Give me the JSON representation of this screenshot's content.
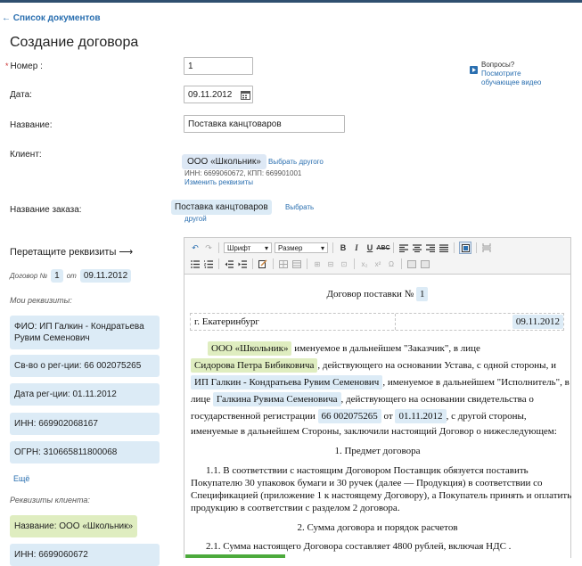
{
  "nav": {
    "back_label": "← Список документов"
  },
  "page": {
    "title": "Создание договора"
  },
  "help": {
    "title": "Вопросы?",
    "link_line1": "Посмотрите",
    "link_line2": "обучающее видео"
  },
  "form": {
    "number": {
      "label": "Номер :",
      "value": "1"
    },
    "date": {
      "label": "Дата:",
      "value": "09.11.2012"
    },
    "name": {
      "label": "Название:",
      "value": "Поставка канцтоваров"
    },
    "client": {
      "label": "Клиент:",
      "chip": "ООО «Школьник»",
      "choose_other": "Выбрать другого",
      "details": "ИНН: 6699060672, КПП: 669901001",
      "change_details": "Изменить реквизиты"
    },
    "order": {
      "label": "Название заказа:",
      "chip": "Поставка канцтоваров",
      "choose_other_1": "Выбрать",
      "choose_other_2": "другой"
    }
  },
  "sidebar": {
    "drag_hint": "Перетащите реквизиты ⟶",
    "contract_prefix": "Договор №",
    "contract_no": "1",
    "contract_from": "от",
    "contract_date": "09.11.2012",
    "my_title": "Мои реквизиты:",
    "my_items": [
      "ФИО: ИП Галкин - Кондратьева Рувим Семенович",
      "Св-во о рег-ции: 66 002075265",
      "Дата рег-ции: 01.11.2012",
      "ИНН: 669902068167",
      "ОГРН: 310665811800068"
    ],
    "more": "Ещё",
    "client_title": "Реквизиты клиента:",
    "client_items": [
      "Название: ООО «Школьник»",
      "ИНН: 6699060672"
    ]
  },
  "toolbar": {
    "font_label": "Шрифт",
    "size_label": "Размер"
  },
  "document": {
    "heading": "Договор поставки №",
    "heading_no": "1",
    "city": "г. Екатеринбург",
    "date": "09.11.2012",
    "p1_chip": "ООО «Школьник»",
    "p1_text": "именуемое в дальнейшем \"Заказчик\", в лице",
    "p2_chip": "Сидорова Петра Бибиковича",
    "p2_text": ", действующего на основании Устава, с одной стороны, и",
    "p3_chip": "ИП Галкин - Кондратьева Рувим Семенович",
    "p3_text": ", именуемое в дальнейшем \"Исполнитель\", в",
    "p4_pre": "лице",
    "p4_chip": "Галкина Рувима Семеновича",
    "p4_text": ", действующего на основании свидетельства о",
    "p5_pre": "государственной регистрации",
    "p5_chip": "66 002075265",
    "p5_mid": "от",
    "p5_chip2": "01.11.2012",
    "p5_text": ", с другой стороны,",
    "p6_text": "именуемые в дальнейшем Стороны, заключили настоящий Договор о нижеследующем:",
    "s1_title": "1. Предмет договора",
    "s1_l1": "1.1. В соответствии с настоящим Договором Поставщик обязуется поставить",
    "s1_l2": "Покупателю 30 упаковок бумаги и 30 ручек (далее — Продукция) в соответствии со",
    "s1_l3": "Спецификацией (приложение 1 к настоящему Договору), а Покупатель принять и оплатить",
    "s1_l4": "продукцию в соответствии с разделом 2 договора.",
    "s2_title": "2. Сумма договора и порядок расчетов",
    "s2_l1": "2.1. Сумма настоящего Договора составляет 4800 рублей, включая НДС ."
  }
}
